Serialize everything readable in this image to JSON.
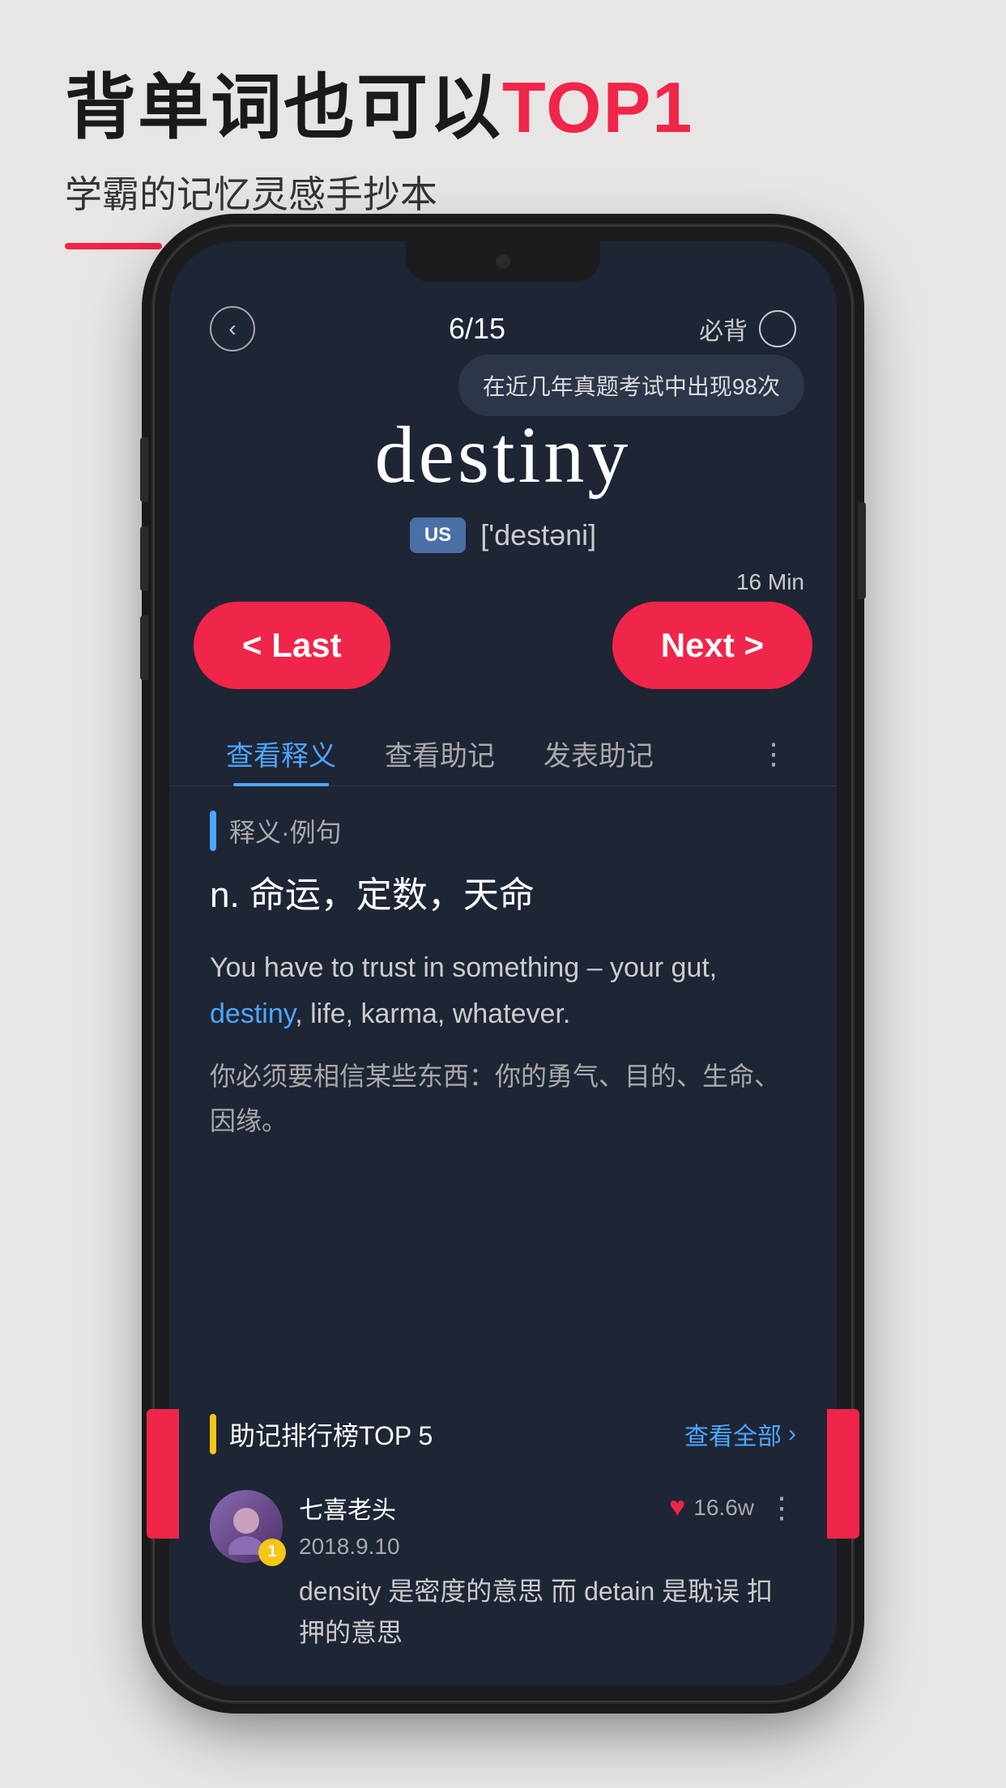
{
  "page": {
    "background_color": "#e8e5e5"
  },
  "header": {
    "title_part1": "背单词也可以",
    "title_part2": "TOP1",
    "subtitle": "学霸的记忆灵感手抄本",
    "accent_color": "#f0254a"
  },
  "phone": {
    "screen": {
      "background": "#1e2535",
      "progress": "6/15",
      "must_memorize_label": "必背",
      "tooltip": "在近几年真题考试中出现98次",
      "word": "destiny",
      "pronunciation_badge": "US",
      "phonetic": "['destəni]",
      "time_label": "16 Min",
      "btn_last": "< Last",
      "btn_next": "Next >",
      "tabs": [
        {
          "label": "查看释义",
          "active": true
        },
        {
          "label": "查看助记",
          "active": false
        },
        {
          "label": "发表助记",
          "active": false
        }
      ],
      "section_label": "释义·例句",
      "definition": "n.  命运，定数，天命",
      "example_en_before": "You have to trust in something –\nyour gut, ",
      "example_en_word": "destiny",
      "example_en_after": ", life, karma, whatever.",
      "example_cn": "你必须要相信某些东西：你的勇气、目的、生命、\n因缘。",
      "mnemonic_title": "助记排行榜TOP 5",
      "view_all": "查看全部",
      "review": {
        "username": "七喜老头",
        "date": "2018.9.10",
        "rank": "1",
        "like_count": "16.6w",
        "text": "density 是密度的意思  而 detain 是耽误\n扣押的意思"
      }
    }
  }
}
